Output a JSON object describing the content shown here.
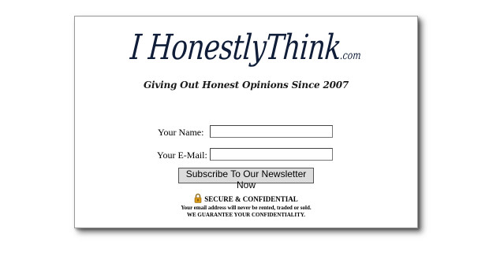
{
  "brand": {
    "name": "I HonestlyThink",
    "tld": ".com",
    "tagline": "Giving Out Honest Opinions Since 2007"
  },
  "form": {
    "name_label": "Your Name:",
    "email_label": "Your E-Mail:",
    "name_value": "",
    "email_value": "",
    "submit_label": "Subscribe To Our Newsletter Now"
  },
  "secure": {
    "title": "SECURE & CONFIDENTIAL",
    "line1": "Your email address will never be rented, traded or sold.",
    "line2": "WE GUARANTEE YOUR CONFIDENTIALITY.",
    "icon": "lock-icon"
  },
  "colors": {
    "logo": "#0f1d38",
    "lock": "#d89a18"
  }
}
